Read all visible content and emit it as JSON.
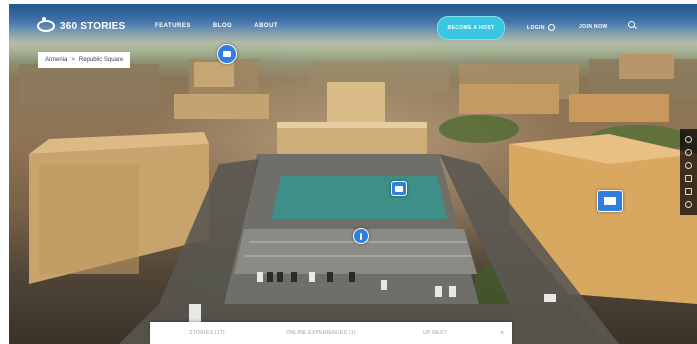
{
  "app": {
    "logo_text": "360 STORIES"
  },
  "nav": {
    "links": [
      "FEATURES",
      "BLOG",
      "ABOUT"
    ],
    "cta_label": "BECOME A HOST",
    "login_label": "LOGIN",
    "join_label": "JOIN NOW"
  },
  "breadcrumb": {
    "parent": "Armenia",
    "separator": ">",
    "current": "Republic Square"
  },
  "bottom_bar": {
    "tabs": [
      "STORIES (17)",
      "ONLINE EXPERIENCES (1)",
      "UP NEXT"
    ],
    "close_symbol": "×"
  },
  "colors": {
    "accent": "#39c6e0",
    "hotspot": "#2f7fe0"
  },
  "icons": {
    "logo": "logo-mark-icon",
    "user": "user-icon",
    "search": "search-icon",
    "sidebar": [
      "share-icon",
      "info-icon",
      "location-icon",
      "map-icon",
      "fullscreen-icon",
      "compass-icon"
    ]
  }
}
